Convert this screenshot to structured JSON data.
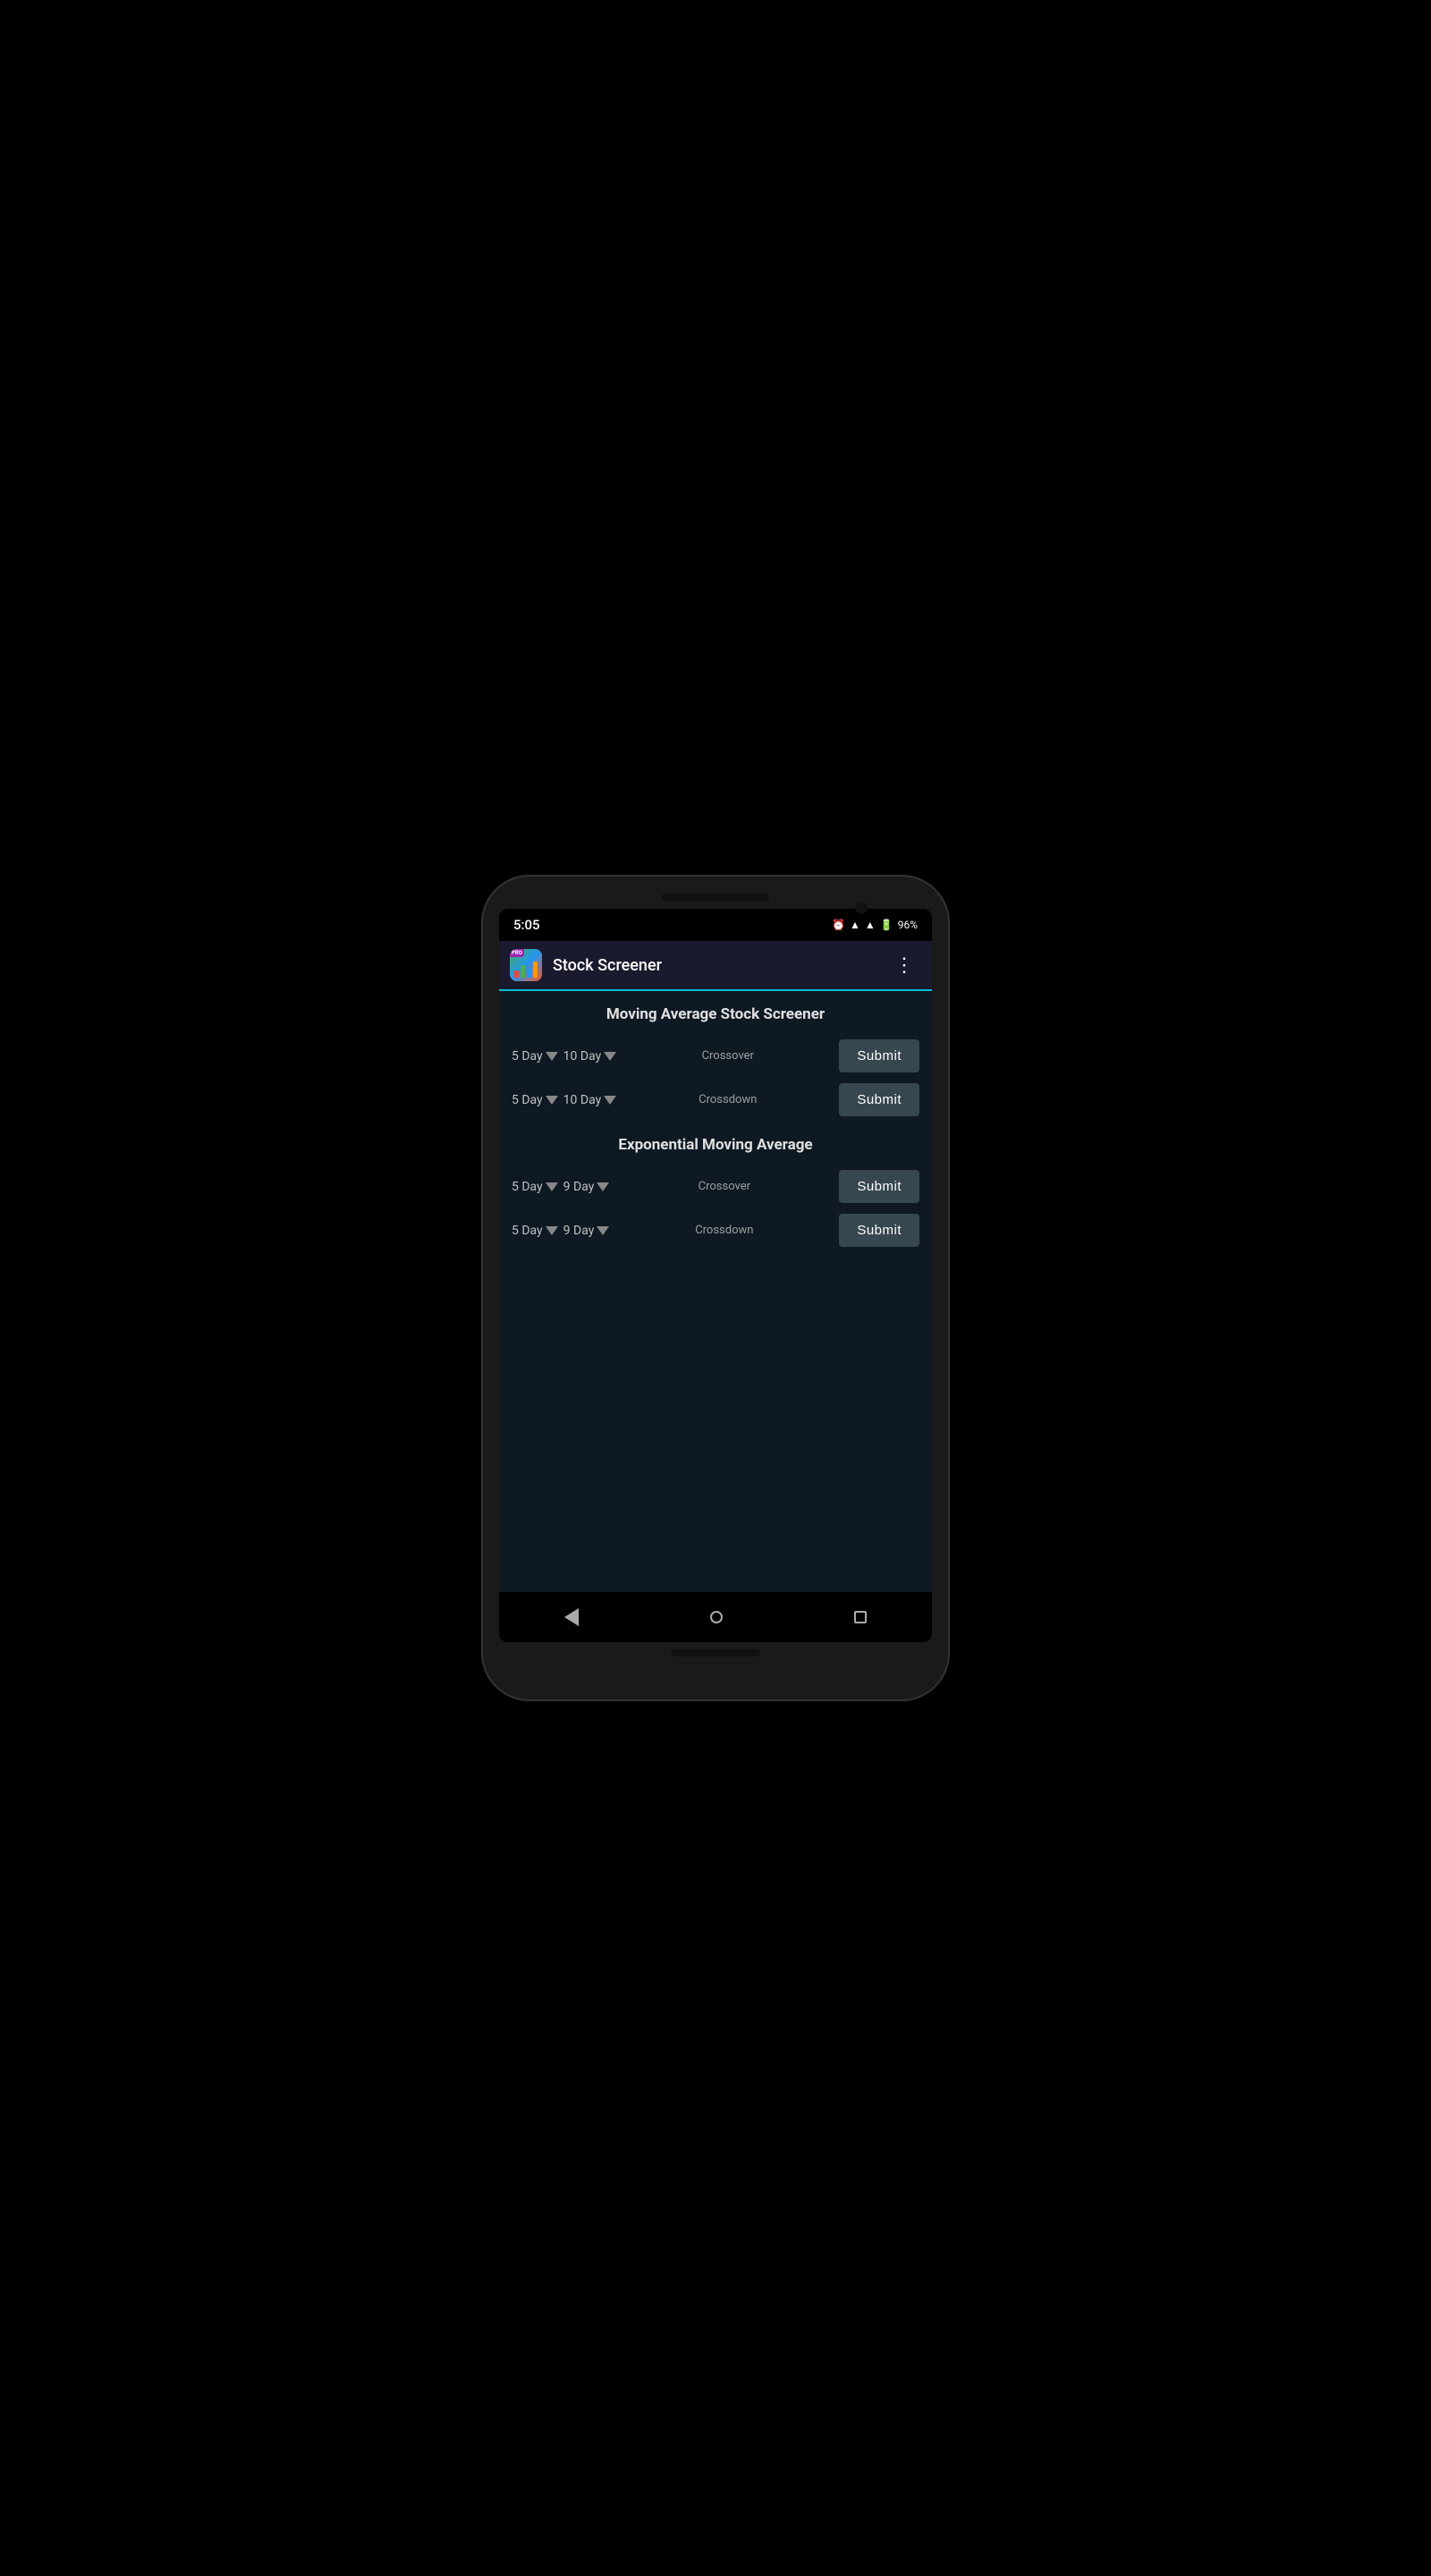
{
  "phone": {
    "status": {
      "time": "5:05",
      "battery": "96%"
    }
  },
  "app": {
    "title": "Stock Screener",
    "more_icon": "⋮"
  },
  "moving_average": {
    "section_title": "Moving Average Stock Screener",
    "rows": [
      {
        "dropdown1": "5 Day",
        "dropdown2": "10 Day",
        "label": "Crossover",
        "button": "Submit"
      },
      {
        "dropdown1": "5 Day",
        "dropdown2": "10 Day",
        "label": "Crossdown",
        "button": "Submit"
      }
    ]
  },
  "exponential_moving_average": {
    "section_title": "Exponential Moving Average",
    "rows": [
      {
        "dropdown1": "5 Day",
        "dropdown2": "9 Day",
        "label": "Crossover",
        "button": "Submit"
      },
      {
        "dropdown1": "5 Day",
        "dropdown2": "9 Day",
        "label": "Crossdown",
        "button": "Submit"
      }
    ]
  },
  "navbar": {
    "back_label": "back",
    "home_label": "home",
    "recent_label": "recent"
  }
}
